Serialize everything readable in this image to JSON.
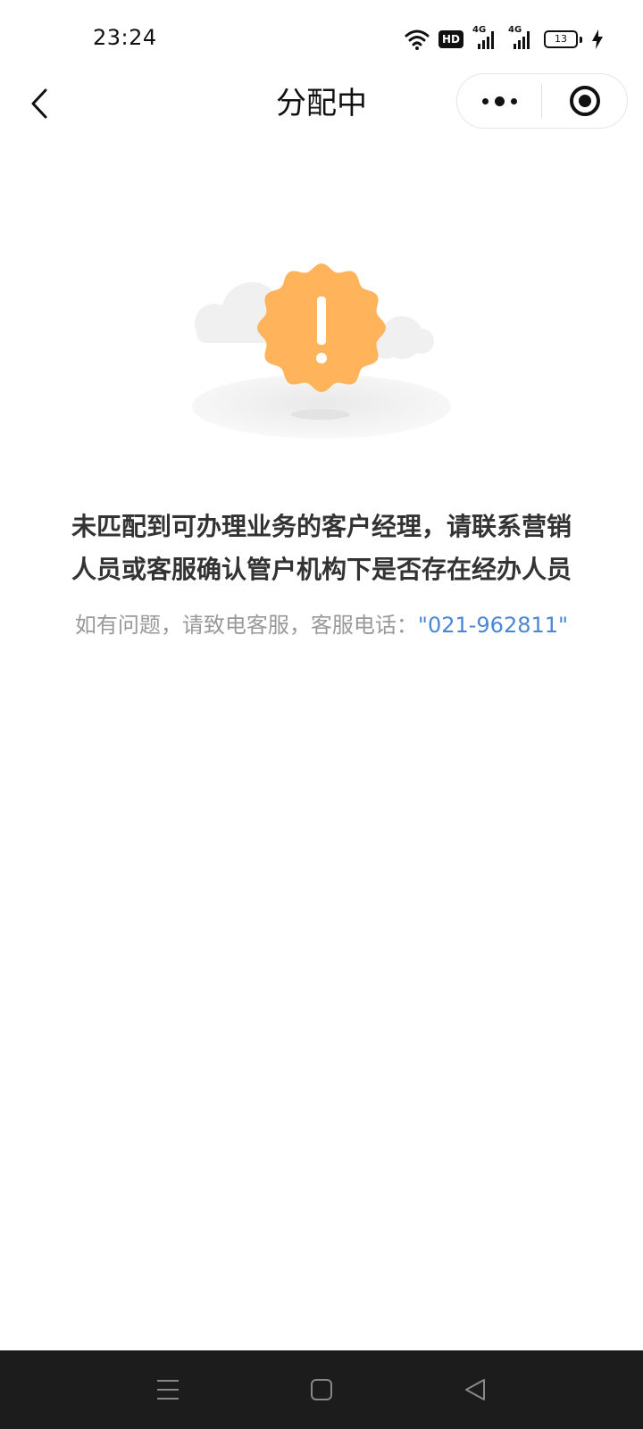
{
  "status_bar": {
    "time": "23:24",
    "hd_label": "HD",
    "network_1": "4G",
    "network_2": "4G",
    "battery_level": "13"
  },
  "nav": {
    "title": "分配中"
  },
  "content": {
    "message_line1": "未匹配到可办理业务的客户经理，请联系营销",
    "message_line2": "人员或客服确认管户机构下是否存在经办人员",
    "help_prefix": "如有问题，请致电客服，客服电话：",
    "phone": "\"021-962811\""
  },
  "colors": {
    "badge_orange": "#FFB45C",
    "link_blue": "#4a86d6",
    "nav_bar_bg": "#1c1c1c"
  }
}
